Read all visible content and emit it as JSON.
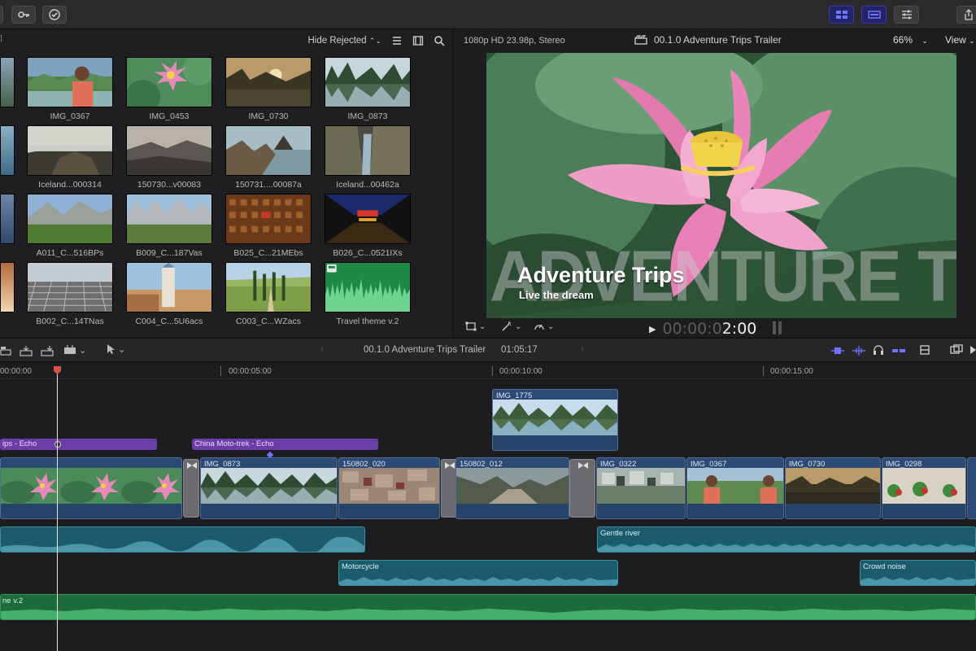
{
  "toolbar": {
    "key_icon": "key-icon",
    "check_icon": "checkmark-icon",
    "share_icon": "share-icon"
  },
  "browser": {
    "filter_label": "Hide Rejected",
    "clips": [
      {
        "name": "IMG_0367",
        "kind": "portrait"
      },
      {
        "name": "IMG_0453",
        "kind": "lotus"
      },
      {
        "name": "IMG_0730",
        "kind": "sunset-river"
      },
      {
        "name": "IMG_0873",
        "kind": "karst-lake"
      },
      {
        "name": "Iceland...000314",
        "kind": "coast"
      },
      {
        "name": "150730...v00083",
        "kind": "grey-rocks"
      },
      {
        "name": "150731....00087a",
        "kind": "rocks-sea"
      },
      {
        "name": "Iceland...00462a",
        "kind": "canyon"
      },
      {
        "name": "A011_C...516BPs",
        "kind": "mountains-green"
      },
      {
        "name": "B009_C...187Vas",
        "kind": "dolomites"
      },
      {
        "name": "B025_C...21MEbs",
        "kind": "studio-foam"
      },
      {
        "name": "B026_C...0521IXs",
        "kind": "tunnel"
      },
      {
        "name": "B002_C...14TNas",
        "kind": "checker-floor"
      },
      {
        "name": "C004_C...5U6acs",
        "kind": "church"
      },
      {
        "name": "C003_C...WZacs",
        "kind": "cypress-road"
      },
      {
        "name": "Travel theme v.2",
        "kind": "audio"
      }
    ]
  },
  "viewer": {
    "format": "1080p HD 23.98p, Stereo",
    "project_title": "00.1.0 Adventure Trips Trailer",
    "zoom": "66%",
    "view_label": "View",
    "background_title": "ADVENTURE TRIPS",
    "overlay_title": "Adventure Trips",
    "overlay_subtitle": "Live the dream",
    "timecode_dim": "00:00:0",
    "timecode_bright": "2:00"
  },
  "timeline": {
    "project_title": "00.1.0 Adventure Trips Trailer",
    "duration": "01:05:17",
    "ruler": [
      "00:00:00",
      "00:00:05:00",
      "00:00:10:00",
      "00:00:15:00"
    ],
    "playhead_fraction": 0.059,
    "connected_clip": "IMG_1775",
    "titles": [
      "ips - Echo",
      "China Moto-trek - Echo"
    ],
    "primary_clips": [
      "",
      "IMG_0873",
      "150802_020",
      "150802_012",
      "IMG_0322",
      "IMG_0367",
      "IMG_0730",
      "IMG_0298"
    ],
    "audio_clips": [
      "",
      "Gentle river",
      "Motorcycle",
      "Crowd noise"
    ],
    "music_label": "ne v.2"
  },
  "colors": {
    "title_purple": "#6a3ea8",
    "video_blue": "#2b4a74",
    "audio_teal": "#1b5b6c",
    "music_green": "#1d6a3a",
    "playhead_red": "#d8504a"
  }
}
